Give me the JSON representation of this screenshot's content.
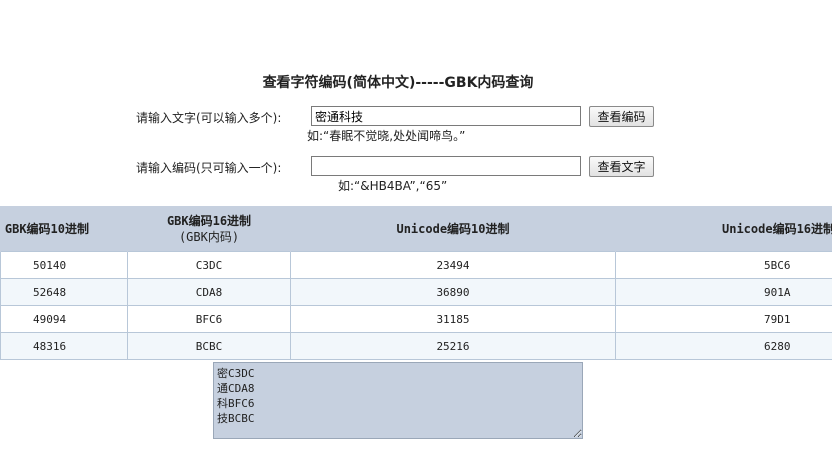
{
  "page": {
    "title": "查看字符编码(简体中文)-----GBK内码查询"
  },
  "text_query": {
    "label": "请输入文字(可以输入多个):",
    "value": "密通科技",
    "button": "查看编码",
    "hint": "如:“春眠不觉晓,处处闻啼鸟。”"
  },
  "code_query": {
    "label": "请输入编码(只可输入一个):",
    "value": "",
    "button": "查看文字",
    "hint": "如:“&HB4BA”,“65”"
  },
  "table": {
    "headers": {
      "gbk10": "GBK编码10进制",
      "gbk16_line1": "GBK编码16进制",
      "gbk16_line2": "(GBK内码)",
      "unicode10": "Unicode编码10进制",
      "unicode16": "Unicode编码16进制"
    },
    "rows": [
      {
        "gbk10": "50140",
        "gbk16": "C3DC",
        "unicode10": "23494",
        "unicode16": "5BC6"
      },
      {
        "gbk10": "52648",
        "gbk16": "CDA8",
        "unicode10": "36890",
        "unicode16": "901A"
      },
      {
        "gbk10": "49094",
        "gbk16": "BFC6",
        "unicode10": "31185",
        "unicode16": "79D1"
      },
      {
        "gbk10": "48316",
        "gbk16": "BCBC",
        "unicode10": "25216",
        "unicode16": "6280"
      }
    ]
  },
  "result": {
    "text": "密C3DC\n通CDA8\n科BFC6\n技BCBC"
  }
}
